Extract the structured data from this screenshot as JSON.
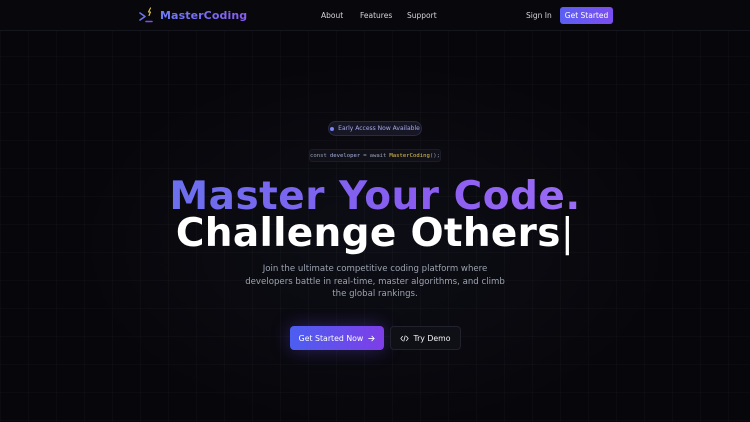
{
  "brand": {
    "name": "MasterCoding",
    "icon": "terminal-spark-icon"
  },
  "nav": {
    "links": [
      {
        "label": "About"
      },
      {
        "label": "Features"
      },
      {
        "label": "Support"
      }
    ],
    "sign_in": "Sign In",
    "get_started": "Get Started"
  },
  "hero": {
    "badge": "Early Access Now Available",
    "code": {
      "keyword": "const",
      "variable": "developer",
      "op": "=",
      "await": "await",
      "fn": "MasterCoding",
      "punct": "();"
    },
    "headline_line1": "Master Your Code.",
    "headline_line2": "Challenge Others",
    "caret": "|",
    "subtitle": "Join the ultimate competitive coding platform where developers battle in real-time, master algorithms, and climb the global rankings.",
    "cta_primary": "Get Started Now",
    "cta_secondary": "Try Demo"
  },
  "colors": {
    "background": "#07070b",
    "accent_start": "#5b5ff2",
    "accent_end": "#7c4ef0",
    "code_function": "#e6c84f"
  }
}
